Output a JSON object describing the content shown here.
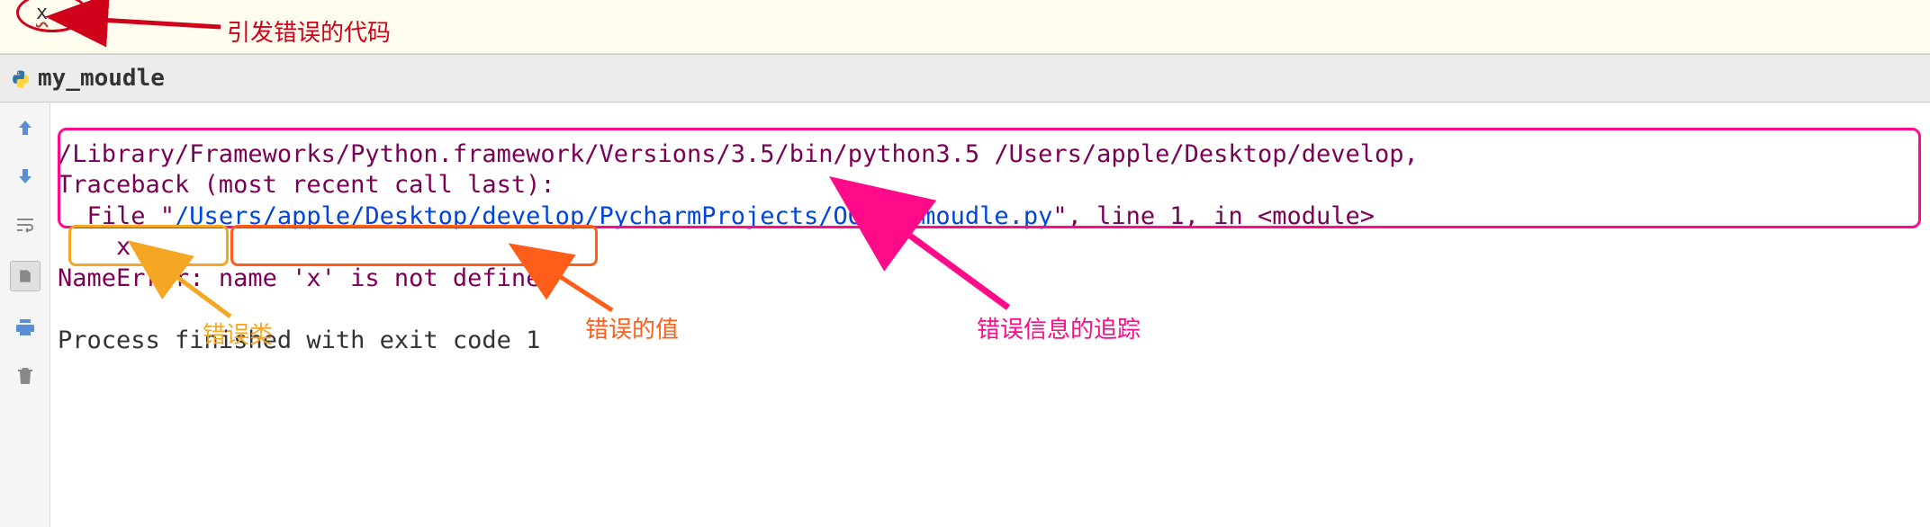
{
  "editor": {
    "code": "x"
  },
  "run_tab": {
    "filename": "my_moudle"
  },
  "console": {
    "cmd": "/Library/Frameworks/Python.framework/Versions/3.5/bin/python3.5 /Users/apple/Desktop/develop,",
    "traceback_header": "Traceback (most recent call last):",
    "file_prefix": "  File \"",
    "file_link": "/Users/apple/Desktop/develop/PycharmProjects/OO/my moudle.py",
    "file_suffix": "\", line 1, in <module>",
    "code_line": "    x",
    "error_name": "NameError",
    "error_colon": ": ",
    "error_msg": "name 'x' is not defined",
    "exit": "Process finished with exit code 1"
  },
  "annotations": {
    "code_label": "引发错误的代码",
    "error_class_label": "错误类",
    "error_value_label": "错误的值",
    "traceback_label": "错误信息的追踪"
  },
  "icons": {
    "up": "arrow-up",
    "down": "arrow-down",
    "wrap": "wrap",
    "export": "export",
    "print": "print",
    "trash": "trash",
    "python": "python"
  }
}
